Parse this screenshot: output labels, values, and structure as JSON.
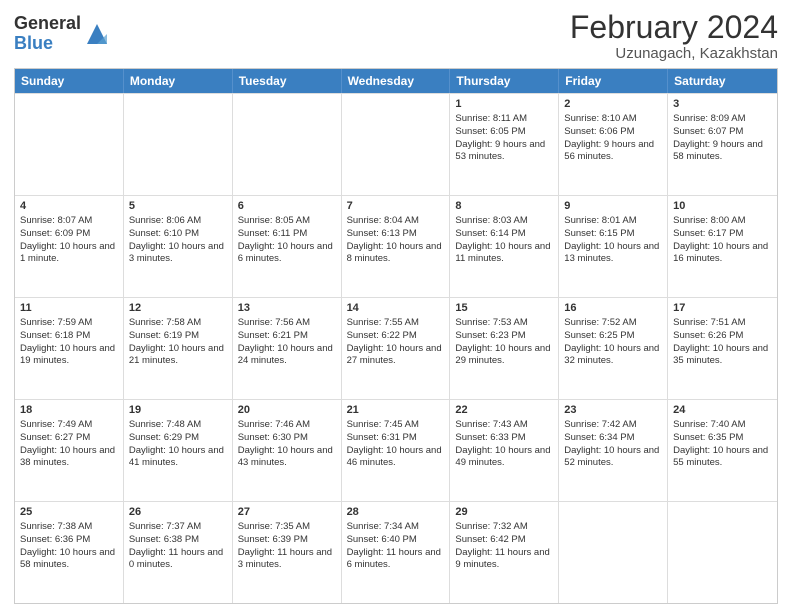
{
  "header": {
    "logo_general": "General",
    "logo_blue": "Blue",
    "title": "February 2024",
    "subtitle": "Uzunagach, Kazakhstan"
  },
  "days_of_week": [
    "Sunday",
    "Monday",
    "Tuesday",
    "Wednesday",
    "Thursday",
    "Friday",
    "Saturday"
  ],
  "weeks": [
    [
      {
        "day": "",
        "info": ""
      },
      {
        "day": "",
        "info": ""
      },
      {
        "day": "",
        "info": ""
      },
      {
        "day": "",
        "info": ""
      },
      {
        "day": "1",
        "info": "Sunrise: 8:11 AM\nSunset: 6:05 PM\nDaylight: 9 hours and 53 minutes."
      },
      {
        "day": "2",
        "info": "Sunrise: 8:10 AM\nSunset: 6:06 PM\nDaylight: 9 hours and 56 minutes."
      },
      {
        "day": "3",
        "info": "Sunrise: 8:09 AM\nSunset: 6:07 PM\nDaylight: 9 hours and 58 minutes."
      }
    ],
    [
      {
        "day": "4",
        "info": "Sunrise: 8:07 AM\nSunset: 6:09 PM\nDaylight: 10 hours and 1 minute."
      },
      {
        "day": "5",
        "info": "Sunrise: 8:06 AM\nSunset: 6:10 PM\nDaylight: 10 hours and 3 minutes."
      },
      {
        "day": "6",
        "info": "Sunrise: 8:05 AM\nSunset: 6:11 PM\nDaylight: 10 hours and 6 minutes."
      },
      {
        "day": "7",
        "info": "Sunrise: 8:04 AM\nSunset: 6:13 PM\nDaylight: 10 hours and 8 minutes."
      },
      {
        "day": "8",
        "info": "Sunrise: 8:03 AM\nSunset: 6:14 PM\nDaylight: 10 hours and 11 minutes."
      },
      {
        "day": "9",
        "info": "Sunrise: 8:01 AM\nSunset: 6:15 PM\nDaylight: 10 hours and 13 minutes."
      },
      {
        "day": "10",
        "info": "Sunrise: 8:00 AM\nSunset: 6:17 PM\nDaylight: 10 hours and 16 minutes."
      }
    ],
    [
      {
        "day": "11",
        "info": "Sunrise: 7:59 AM\nSunset: 6:18 PM\nDaylight: 10 hours and 19 minutes."
      },
      {
        "day": "12",
        "info": "Sunrise: 7:58 AM\nSunset: 6:19 PM\nDaylight: 10 hours and 21 minutes."
      },
      {
        "day": "13",
        "info": "Sunrise: 7:56 AM\nSunset: 6:21 PM\nDaylight: 10 hours and 24 minutes."
      },
      {
        "day": "14",
        "info": "Sunrise: 7:55 AM\nSunset: 6:22 PM\nDaylight: 10 hours and 27 minutes."
      },
      {
        "day": "15",
        "info": "Sunrise: 7:53 AM\nSunset: 6:23 PM\nDaylight: 10 hours and 29 minutes."
      },
      {
        "day": "16",
        "info": "Sunrise: 7:52 AM\nSunset: 6:25 PM\nDaylight: 10 hours and 32 minutes."
      },
      {
        "day": "17",
        "info": "Sunrise: 7:51 AM\nSunset: 6:26 PM\nDaylight: 10 hours and 35 minutes."
      }
    ],
    [
      {
        "day": "18",
        "info": "Sunrise: 7:49 AM\nSunset: 6:27 PM\nDaylight: 10 hours and 38 minutes."
      },
      {
        "day": "19",
        "info": "Sunrise: 7:48 AM\nSunset: 6:29 PM\nDaylight: 10 hours and 41 minutes."
      },
      {
        "day": "20",
        "info": "Sunrise: 7:46 AM\nSunset: 6:30 PM\nDaylight: 10 hours and 43 minutes."
      },
      {
        "day": "21",
        "info": "Sunrise: 7:45 AM\nSunset: 6:31 PM\nDaylight: 10 hours and 46 minutes."
      },
      {
        "day": "22",
        "info": "Sunrise: 7:43 AM\nSunset: 6:33 PM\nDaylight: 10 hours and 49 minutes."
      },
      {
        "day": "23",
        "info": "Sunrise: 7:42 AM\nSunset: 6:34 PM\nDaylight: 10 hours and 52 minutes."
      },
      {
        "day": "24",
        "info": "Sunrise: 7:40 AM\nSunset: 6:35 PM\nDaylight: 10 hours and 55 minutes."
      }
    ],
    [
      {
        "day": "25",
        "info": "Sunrise: 7:38 AM\nSunset: 6:36 PM\nDaylight: 10 hours and 58 minutes."
      },
      {
        "day": "26",
        "info": "Sunrise: 7:37 AM\nSunset: 6:38 PM\nDaylight: 11 hours and 0 minutes."
      },
      {
        "day": "27",
        "info": "Sunrise: 7:35 AM\nSunset: 6:39 PM\nDaylight: 11 hours and 3 minutes."
      },
      {
        "day": "28",
        "info": "Sunrise: 7:34 AM\nSunset: 6:40 PM\nDaylight: 11 hours and 6 minutes."
      },
      {
        "day": "29",
        "info": "Sunrise: 7:32 AM\nSunset: 6:42 PM\nDaylight: 11 hours and 9 minutes."
      },
      {
        "day": "",
        "info": ""
      },
      {
        "day": "",
        "info": ""
      }
    ]
  ]
}
